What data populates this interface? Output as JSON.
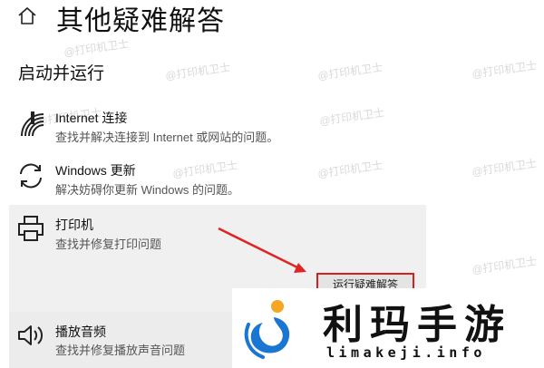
{
  "header": {
    "title": "其他疑难解答"
  },
  "section": {
    "title": "启动并运行"
  },
  "items": [
    {
      "title": "Internet 连接",
      "desc": "查找并解决连接到 Internet 或网站的问题。",
      "icon": "wifi-icon"
    },
    {
      "title": "Windows 更新",
      "desc": "解决妨碍你更新 Windows 的问题。",
      "icon": "refresh-icon"
    },
    {
      "title": "打印机",
      "desc": "查找并修复打印问题",
      "icon": "printer-icon",
      "button": "运行疑难解答"
    },
    {
      "title": "播放音频",
      "desc": "查找并修复播放声音问题",
      "icon": "speaker-icon"
    }
  ],
  "watermark": "@打印机卫士",
  "overlay_logo": {
    "cn": "利玛手游",
    "en": "limakeji.info"
  },
  "colors": {
    "highlight_border": "#d32020",
    "arrow": "#e02424",
    "selected_bg": "#f0f0f0",
    "logo_blue": "#1976d2"
  }
}
